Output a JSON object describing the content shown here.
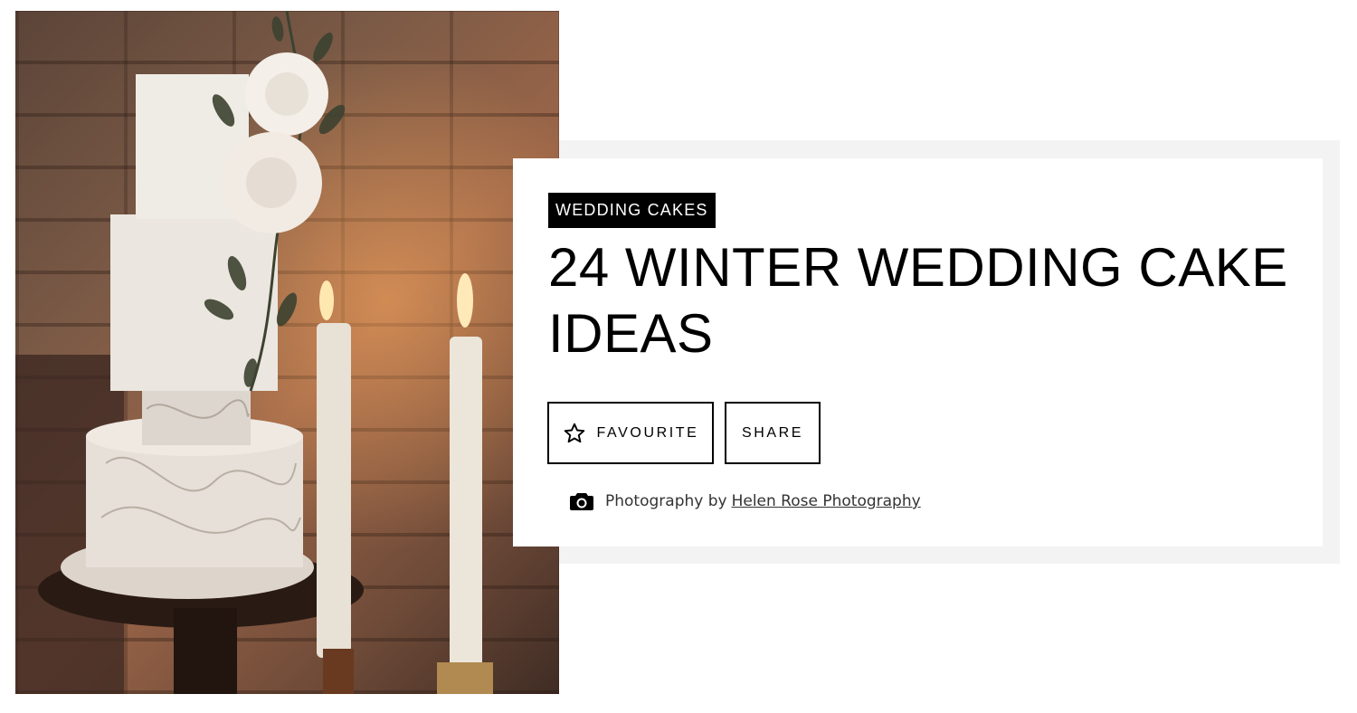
{
  "hero": {
    "image_alt": "Three-tier white winter wedding cake with sugar roses beside tall candles against a brick wall"
  },
  "article": {
    "category": "WEDDING CAKES",
    "title": "24 WINTER WEDDING CAKE IDEAS",
    "actions": {
      "favourite_label": "FAVOURITE",
      "favourite_icon": "star-outline-icon",
      "share_label": "SHARE"
    },
    "credit": {
      "icon": "camera-icon",
      "prefix": "Photography by",
      "photographer": "Helen Rose Photography"
    }
  },
  "colors": {
    "text": "#000000",
    "badge_bg": "#000000",
    "badge_text": "#ffffff",
    "card_shadow": "#f3f3f3",
    "credit_text": "#333333"
  }
}
